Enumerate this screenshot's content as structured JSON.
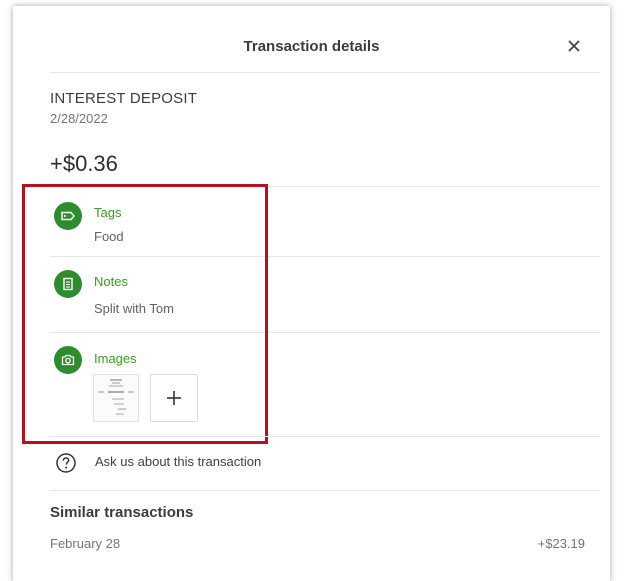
{
  "header": {
    "title": "Transaction details",
    "close_icon": "close-icon"
  },
  "transaction": {
    "merchant": "INTEREST DEPOSIT",
    "date": "2/28/2022",
    "amount": "+$0.36"
  },
  "sections": {
    "tags": {
      "label": "Tags",
      "value": "Food",
      "icon": "tag-icon"
    },
    "notes": {
      "label": "Notes",
      "value": "Split with Tom",
      "icon": "notes-icon"
    },
    "images": {
      "label": "Images",
      "icon": "camera-icon",
      "add_icon": "plus-icon"
    }
  },
  "ask": {
    "label": "Ask us about this transaction",
    "icon": "help-circle-icon"
  },
  "similar": {
    "title": "Similar transactions",
    "items": [
      {
        "date": "February 28",
        "amount": "+$23.19"
      }
    ]
  },
  "colors": {
    "accent_green": "#2e8b2e",
    "label_green": "#3c9a24",
    "highlight_red": "#b5121b"
  }
}
